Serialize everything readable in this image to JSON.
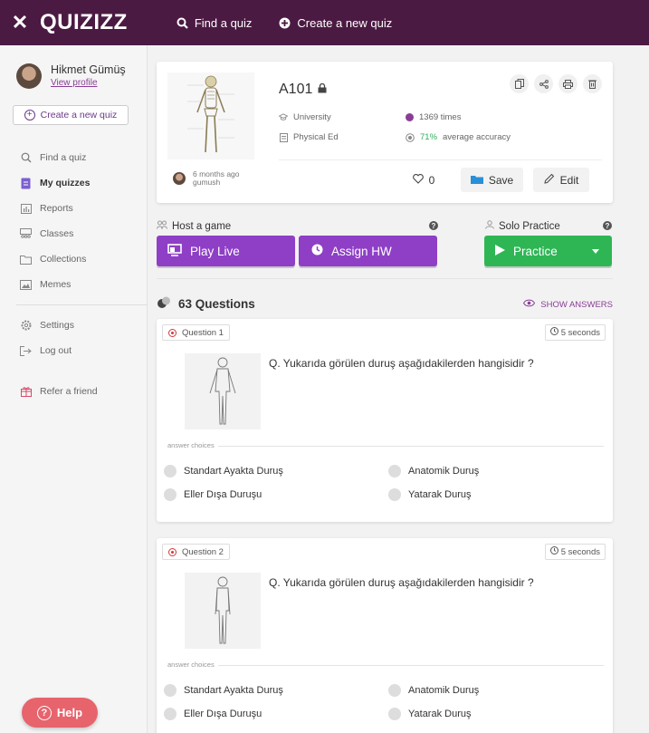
{
  "topbar": {
    "brand": "QUIZIZZ",
    "find_quiz": "Find a quiz",
    "create_quiz": "Create a new quiz"
  },
  "sidebar": {
    "user_name": "Hikmet Gümüş",
    "view_profile": "View profile",
    "create_quiz": "Create a new quiz",
    "items": [
      {
        "label": "Find a quiz",
        "icon": "search-icon"
      },
      {
        "label": "My quizzes",
        "icon": "document-icon",
        "active": true
      },
      {
        "label": "Reports",
        "icon": "bar-chart-icon"
      },
      {
        "label": "Classes",
        "icon": "classes-icon"
      },
      {
        "label": "Collections",
        "icon": "folder-icon"
      },
      {
        "label": "Memes",
        "icon": "image-icon"
      },
      {
        "label": "Settings",
        "icon": "gear-icon"
      },
      {
        "label": "Log out",
        "icon": "logout-icon"
      },
      {
        "label": "Refer a friend",
        "icon": "gift-icon"
      }
    ],
    "help": "Help"
  },
  "quiz": {
    "title": "A101",
    "level": "University",
    "subject": "Physical Ed",
    "times": "1369 times",
    "accuracy": "71%",
    "accuracy_suffix": "average accuracy",
    "author_time": "6 months ago",
    "author_name": "gumush",
    "likes": "0",
    "save": "Save",
    "edit": "Edit"
  },
  "actions": {
    "host_label": "Host a game",
    "solo_label": "Solo Practice",
    "play_live": "Play Live",
    "assign_hw": "Assign HW",
    "practice": "Practice"
  },
  "questions_header": {
    "count": "63 Questions",
    "show_answers": "SHOW ANSWERS"
  },
  "questions": [
    {
      "label": "Question 1",
      "time": "5 seconds",
      "text": "Q. Yukarıda görülen duruş aşağıdakilerden hangisidir ?",
      "choices_label": "answer choices",
      "choices": [
        "Standart Ayakta Duruş",
        "Anatomik Duruş",
        "Eller Dışa Duruşu",
        "Yatarak Duruş"
      ]
    },
    {
      "label": "Question 2",
      "time": "5 seconds",
      "text": "Q. Yukarıda görülen duruş aşağıdakilerden hangisidir ?",
      "choices_label": "answer choices",
      "choices": [
        "Standart Ayakta Duruş",
        "Anatomik Duruş",
        "Eller Dışa Duruşu",
        "Yatarak Duruş"
      ]
    }
  ],
  "colors": {
    "topbar": "#4b1a42",
    "purple_button": "#8e3fc6",
    "green_button": "#2eb654",
    "help_button": "#e7646d"
  }
}
